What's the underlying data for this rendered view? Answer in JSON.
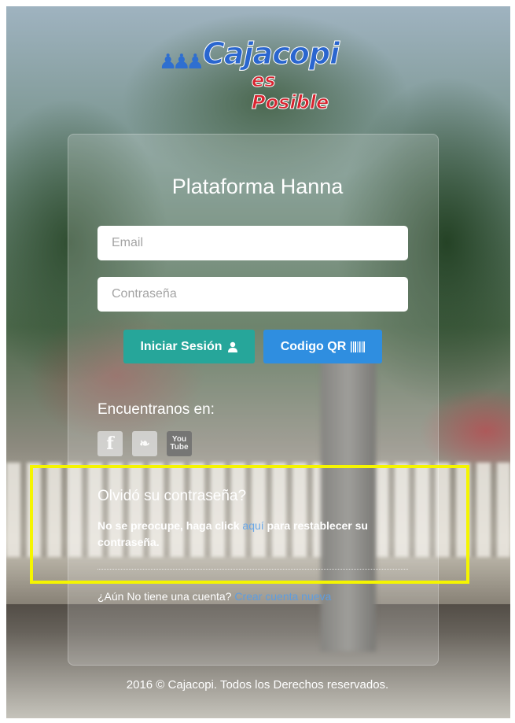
{
  "logo": {
    "mark": "♟♟♟",
    "brand": "Cajacopi",
    "slogan": "es Posible"
  },
  "login": {
    "title": "Plataforma Hanna",
    "email_placeholder": "Email",
    "password_placeholder": "Contraseña",
    "login_button": "Iniciar Sesión",
    "qr_button": "Codigo QR"
  },
  "social": {
    "label": "Encuentranos en:",
    "icons": [
      "facebook-icon",
      "twitter-icon",
      "youtube-icon"
    ],
    "facebook_glyph": "f",
    "twitter_glyph": "❧",
    "youtube_top": "You",
    "youtube_bottom": "Tube"
  },
  "forgot": {
    "title": "Olvidó su contraseña?",
    "text_before": "No se preocupe, haga click ",
    "link": "aquí",
    "text_after": " para restablecer su contraseña."
  },
  "register": {
    "question": "¿Aún No tiene una cuenta? ",
    "link": "Crear cuenta nueva"
  },
  "footer": {
    "text": "2016 © Cajacopi. Todos los Derechos reservados."
  },
  "colors": {
    "login_button": "#26a69a",
    "qr_button": "#2f8ee0",
    "highlight": "#f5f500",
    "link": "#6aa8e8"
  }
}
